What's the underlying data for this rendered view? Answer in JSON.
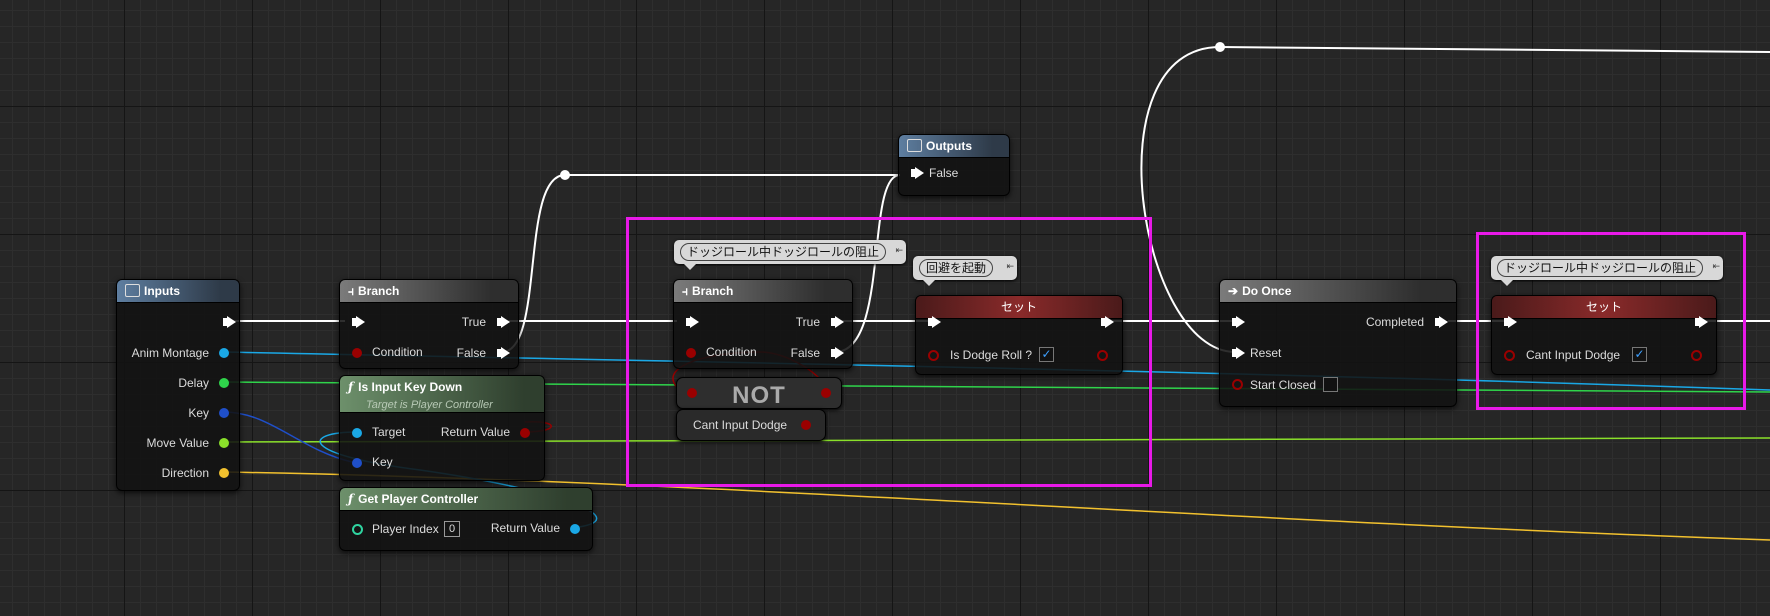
{
  "colors": {
    "exec": "#ffffff",
    "bool": "#9a0000",
    "object": "#1aa8e6",
    "struct_key": "#1f4fc9",
    "float": "#8ae02a",
    "int_green": "#2fd44b",
    "enum": "#f2c12e",
    "selection": "#e819e8"
  },
  "inputs_node": {
    "title": "Inputs",
    "pins": [
      "Anim Montage",
      "Delay",
      "Key",
      "Move Value",
      "Direction"
    ]
  },
  "branch1": {
    "title": "Branch",
    "true_label": "True",
    "condition_label": "Condition",
    "false_label": "False"
  },
  "is_input_key_down": {
    "title": "Is Input Key Down",
    "subtitle": "Target is Player Controller",
    "target_label": "Target",
    "key_label": "Key",
    "return_label": "Return Value"
  },
  "get_player_controller": {
    "title": "Get Player Controller",
    "player_index_label": "Player Index",
    "player_index_value": "0",
    "return_label": "Return Value"
  },
  "outputs_node": {
    "title": "Outputs",
    "false_label": "False"
  },
  "comment1": "ドッジロール中ドッジロールの阻止",
  "branch2": {
    "title": "Branch",
    "true_label": "True",
    "condition_label": "Condition",
    "false_label": "False"
  },
  "not_node": {
    "label": "NOT"
  },
  "cant_input_getter": {
    "label": "Cant Input Dodge"
  },
  "comment2": "回避を起動",
  "set1": {
    "title": "セット",
    "var_label": "Is Dodge Roll ?",
    "checkbox": "✓"
  },
  "do_once": {
    "title": "Do Once",
    "completed_label": "Completed",
    "reset_label": "Reset",
    "start_closed_label": "Start Closed"
  },
  "comment3": "ドッジロール中ドッジロールの阻止",
  "set2": {
    "title": "セット",
    "var_label": "Cant Input Dodge",
    "checkbox": "✓"
  }
}
